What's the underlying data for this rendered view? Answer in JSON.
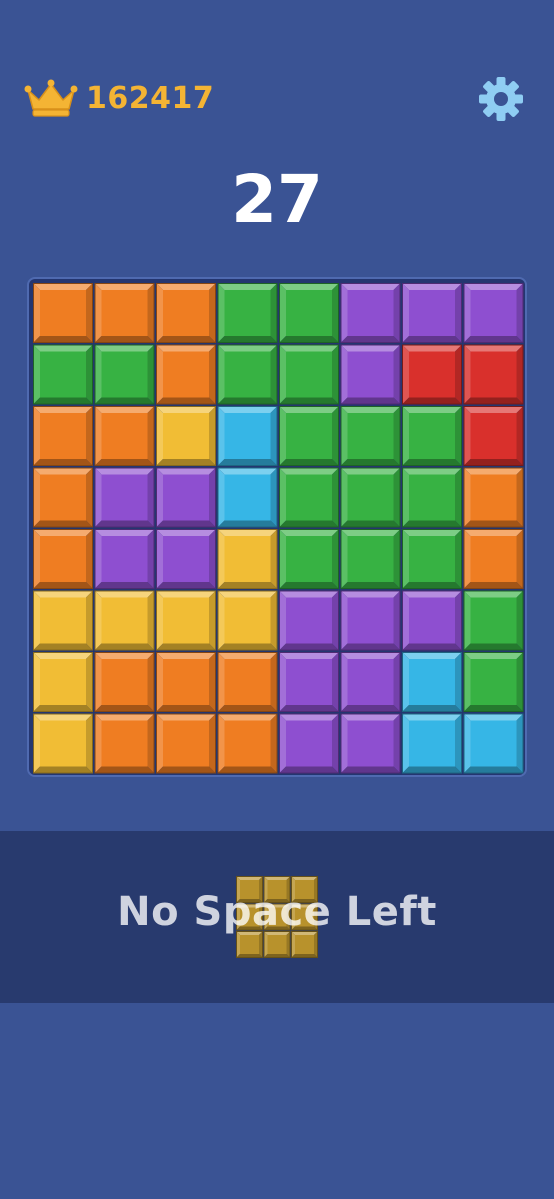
{
  "header": {
    "best_icon": "crown-icon",
    "best_score": "162417",
    "settings_icon": "gear-icon"
  },
  "score": "27",
  "colors": {
    "O": "#ef7d22",
    "G": "#37b243",
    "P": "#8e4fd0",
    "R": "#d9302c",
    "Y": "#f1bd35",
    "B": "#36b6e6",
    "crown": "#f4b434",
    "gear": "#8fcdf3",
    "piece": "#b8922c"
  },
  "board": {
    "rows": [
      [
        "O",
        "O",
        "O",
        "G",
        "G",
        "P",
        "P",
        "P"
      ],
      [
        "G",
        "G",
        "O",
        "G",
        "G",
        "P",
        "R",
        "R"
      ],
      [
        "O",
        "O",
        "Y",
        "B",
        "G",
        "G",
        "G",
        "R"
      ],
      [
        "O",
        "P",
        "P",
        "B",
        "G",
        "G",
        "G",
        "O"
      ],
      [
        "O",
        "P",
        "P",
        "Y",
        "G",
        "G",
        "G",
        "O"
      ],
      [
        "Y",
        "Y",
        "Y",
        "Y",
        "P",
        "P",
        "P",
        "G"
      ],
      [
        "Y",
        "O",
        "O",
        "O",
        "P",
        "P",
        "B",
        "G"
      ],
      [
        "Y",
        "O",
        "O",
        "O",
        "P",
        "P",
        "B",
        "B"
      ]
    ]
  },
  "tray": {
    "message": "No Space Left",
    "piece": {
      "rows": 3,
      "cols": 3
    }
  }
}
